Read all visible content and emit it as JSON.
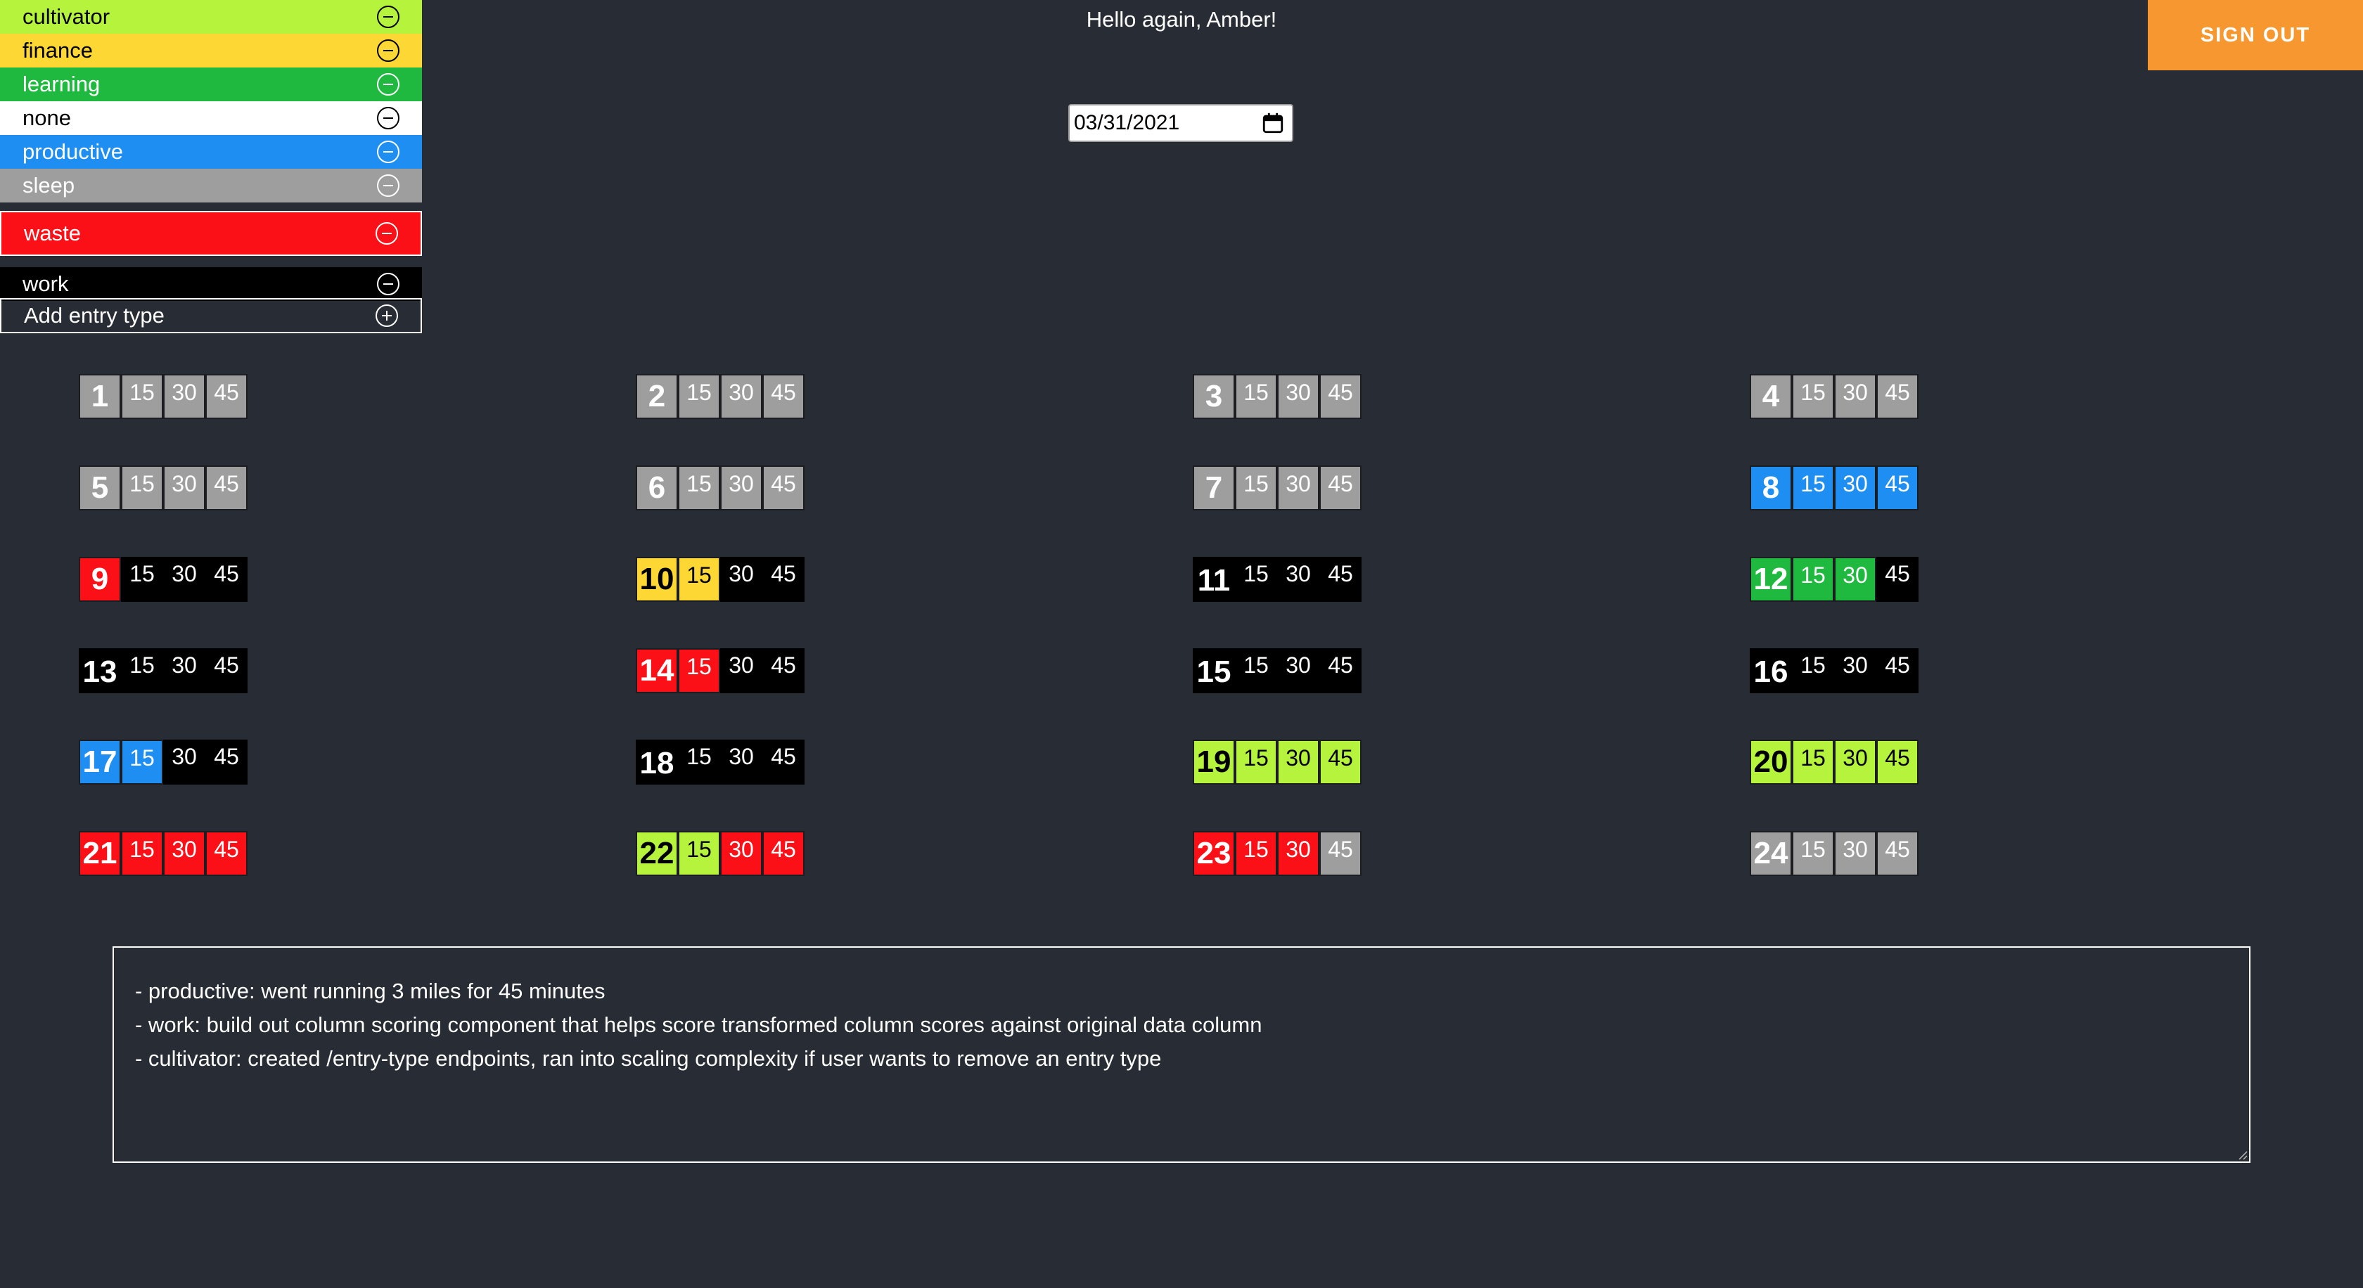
{
  "greeting": "Hello again, Amber!",
  "sign_out_label": "SIGN OUT",
  "date_value": "03/31/2021",
  "colors": {
    "cultivator": "#b6f33c",
    "finance": "#fdd835",
    "learning": "#1fb93f",
    "none": "#ffffff",
    "productive": "#1e8ef2",
    "sleep": "#9e9e9e",
    "waste": "#fb1018",
    "work": "#000000",
    "accent": "#f6982f",
    "background": "#282c34"
  },
  "entry_types": [
    {
      "label": "cultivator",
      "key": "cultivator",
      "action_icon": "minus-circle-icon"
    },
    {
      "label": "finance",
      "key": "finance",
      "action_icon": "minus-circle-icon"
    },
    {
      "label": "learning",
      "key": "learning",
      "action_icon": "minus-circle-icon"
    },
    {
      "label": "none",
      "key": "none",
      "action_icon": "minus-circle-icon"
    },
    {
      "label": "productive",
      "key": "productive",
      "action_icon": "minus-circle-icon"
    },
    {
      "label": "sleep",
      "key": "sleep",
      "action_icon": "minus-circle-icon"
    },
    {
      "label": "waste",
      "key": "waste",
      "action_icon": "minus-circle-icon"
    },
    {
      "label": "work",
      "key": "work",
      "action_icon": "minus-circle-icon"
    }
  ],
  "add_entry_type": {
    "label": "Add entry type",
    "action_icon": "plus-circle-icon"
  },
  "quarter_labels": [
    "15",
    "30",
    "45"
  ],
  "hours": [
    {
      "hour": "1",
      "slots": [
        "sleep",
        "sleep",
        "sleep",
        "sleep"
      ]
    },
    {
      "hour": "2",
      "slots": [
        "sleep",
        "sleep",
        "sleep",
        "sleep"
      ]
    },
    {
      "hour": "3",
      "slots": [
        "sleep",
        "sleep",
        "sleep",
        "sleep"
      ]
    },
    {
      "hour": "4",
      "slots": [
        "sleep",
        "sleep",
        "sleep",
        "sleep"
      ]
    },
    {
      "hour": "5",
      "slots": [
        "sleep",
        "sleep",
        "sleep",
        "sleep"
      ]
    },
    {
      "hour": "6",
      "slots": [
        "sleep",
        "sleep",
        "sleep",
        "sleep"
      ]
    },
    {
      "hour": "7",
      "slots": [
        "sleep",
        "sleep",
        "sleep",
        "sleep"
      ]
    },
    {
      "hour": "8",
      "slots": [
        "productive",
        "productive",
        "productive",
        "productive"
      ]
    },
    {
      "hour": "9",
      "slots": [
        "waste",
        "work",
        "work",
        "work"
      ]
    },
    {
      "hour": "10",
      "slots": [
        "finance",
        "finance",
        "work",
        "work"
      ]
    },
    {
      "hour": "11",
      "slots": [
        "work",
        "work",
        "work",
        "work"
      ]
    },
    {
      "hour": "12",
      "slots": [
        "learning",
        "learning",
        "learning",
        "work"
      ]
    },
    {
      "hour": "13",
      "slots": [
        "work",
        "work",
        "work",
        "work"
      ]
    },
    {
      "hour": "14",
      "slots": [
        "waste",
        "waste",
        "work",
        "work"
      ]
    },
    {
      "hour": "15",
      "slots": [
        "work",
        "work",
        "work",
        "work"
      ]
    },
    {
      "hour": "16",
      "slots": [
        "work",
        "work",
        "work",
        "work"
      ]
    },
    {
      "hour": "17",
      "slots": [
        "productive",
        "productive",
        "work",
        "work"
      ]
    },
    {
      "hour": "18",
      "slots": [
        "work",
        "work",
        "work",
        "work"
      ]
    },
    {
      "hour": "19",
      "slots": [
        "cultivator",
        "cultivator",
        "cultivator",
        "cultivator"
      ]
    },
    {
      "hour": "20",
      "slots": [
        "cultivator",
        "cultivator",
        "cultivator",
        "cultivator"
      ]
    },
    {
      "hour": "21",
      "slots": [
        "waste",
        "waste",
        "waste",
        "waste"
      ]
    },
    {
      "hour": "22",
      "slots": [
        "cultivator",
        "cultivator",
        "waste",
        "waste"
      ]
    },
    {
      "hour": "23",
      "slots": [
        "waste",
        "waste",
        "waste",
        "sleep"
      ]
    },
    {
      "hour": "24",
      "slots": [
        "sleep",
        "sleep",
        "sleep",
        "sleep"
      ]
    }
  ],
  "journal_lines": [
    "- productive: went running 3 miles for 45 minutes",
    "- work: build out column scoring component that helps score transformed column scores against original data column",
    "- cultivator: created /entry-type endpoints, ran into scaling complexity if user wants to remove an entry type"
  ]
}
